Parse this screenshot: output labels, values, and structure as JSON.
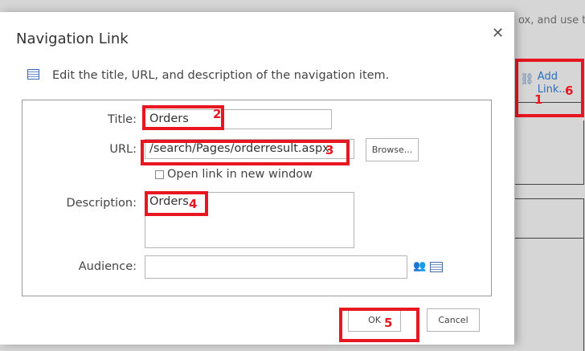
{
  "background": {
    "partial_text": "ox, and use the",
    "add_link_label": "Add Link...",
    "lines": [
      "Add",
      "Link..."
    ]
  },
  "dialog": {
    "title": "Navigation Link",
    "close_icon": "close-icon",
    "intro": "Edit the title, URL, and description of the navigation item.",
    "fields": {
      "title_label": "Title:",
      "title_value": "Orders",
      "url_label": "URL:",
      "url_value": "/search/Pages/orderresult.aspx",
      "browse_label": "Browse...",
      "new_window_label": "Open link in new window",
      "new_window_checked": false,
      "description_label": "Description:",
      "description_value": "Orders",
      "audience_label": "Audience:",
      "audience_value": ""
    },
    "ok_label": "OK",
    "cancel_label": "Cancel"
  },
  "annotations": {
    "a1": "1",
    "a2": "2",
    "a3": "3",
    "a4": "4",
    "a5": "5",
    "a6": "6"
  },
  "colors": {
    "annotation": "#e8161f",
    "link": "#2a6ebb"
  }
}
